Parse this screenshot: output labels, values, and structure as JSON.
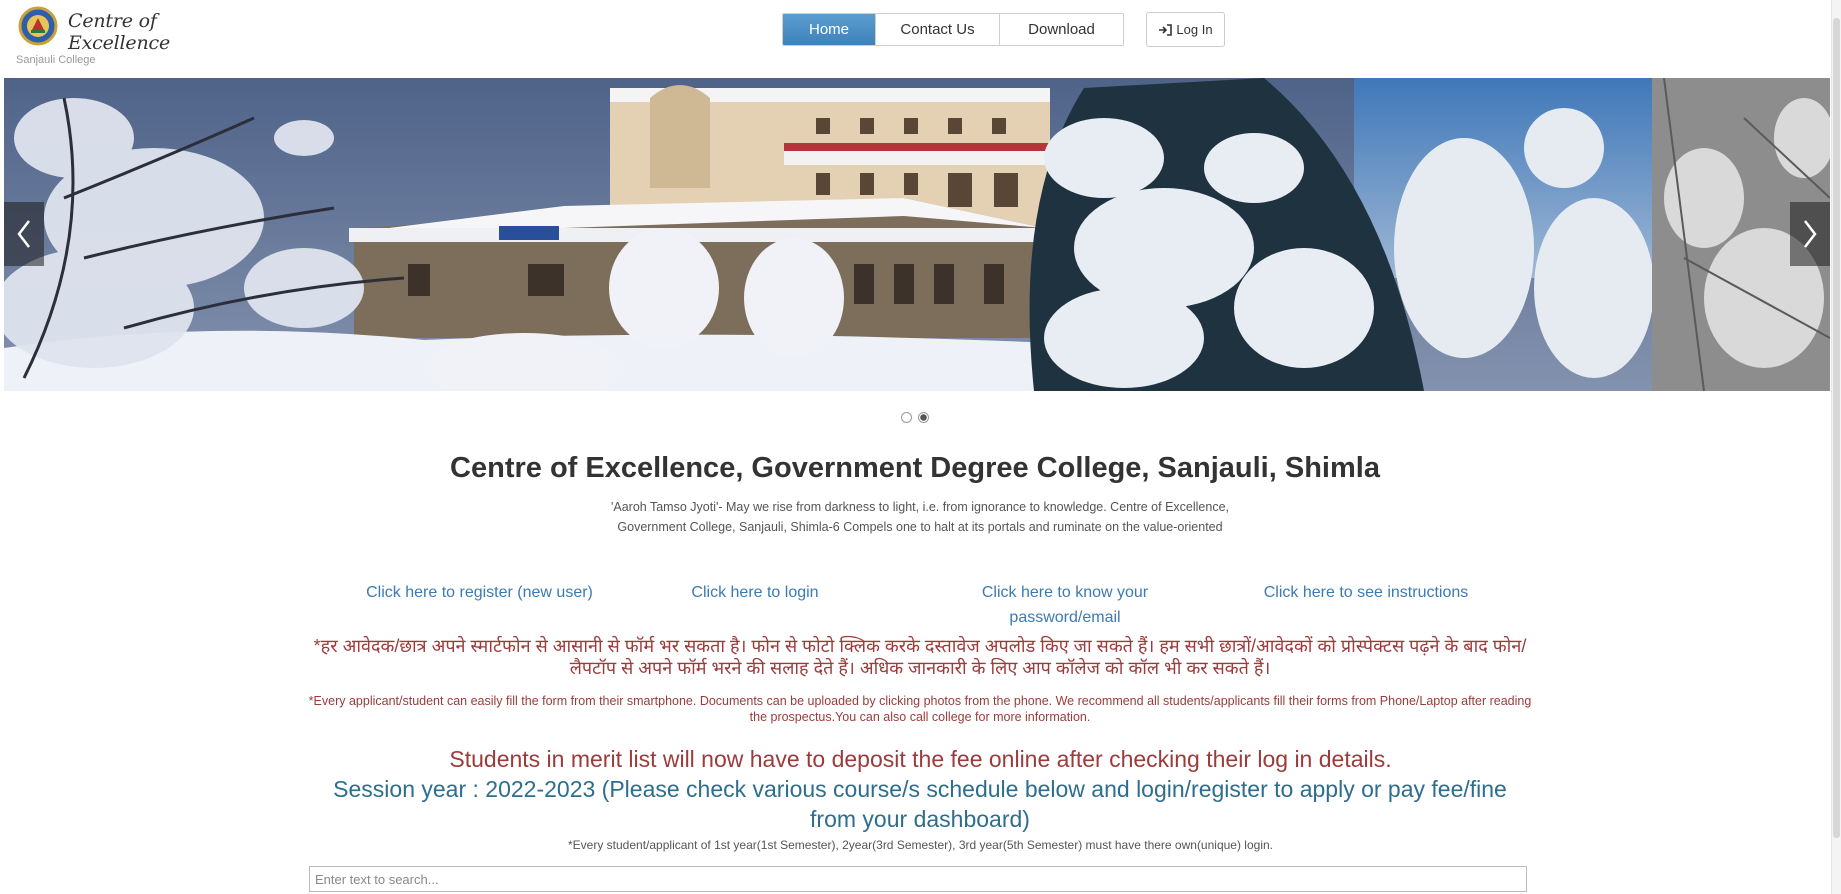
{
  "header": {
    "logo_title": "Centre of Excellence",
    "logo_subtitle": "Sanjauli College",
    "nav": {
      "home": "Home",
      "contact": "Contact Us",
      "download": "Download"
    },
    "login_label": "Log In"
  },
  "carousel": {
    "slide_count": 2,
    "active_slide": 2
  },
  "main": {
    "title": "Centre of Excellence, Government Degree College, Sanjauli, Shimla",
    "intro": "'Aaroh Tamso Jyoti'- May we rise from darkness to light, i.e. from ignorance to knowledge. Centre of Excellence, Government College, Sanjauli, Shimla-6 Compels one to halt at its portals and ruminate on the value-oriented",
    "links": {
      "register": "Click here to register (new user)",
      "login": "Click here to login",
      "password": "Click here to know your password/email",
      "instructions": "Click here to see instructions"
    },
    "hindi_note": "*हर आवेदक/छात्र अपने स्मार्टफोन से आसानी से फॉर्म भर सकता है। फोन से फोटो क्लिक करके दस्तावेज अपलोड किए जा सकते हैं। हम सभी छात्रों/आवेदकों को प्रोस्पेक्टस पढ़ने के बाद फोन/लैपटॉप से अपने फॉर्म भरने की सलाह देते हैं। अधिक जानकारी के लिए आप कॉलेज को कॉल भी कर सकते हैं।",
    "english_note": "*Every applicant/student can easily fill the form from their smartphone. Documents can be uploaded by clicking photos from the phone. We recommend all students/applicants fill their forms from Phone/Laptop after reading the prospectus.You can also call college for more information.",
    "merit_notice": "Students in merit list will now have to deposit the fee online after checking their log in details.",
    "session_notice": "Session year : 2022-2023 (Please check various course/s schedule below and login/register to apply or pay fee/fine from your dashboard)",
    "unique_login_note": "*Every student/applicant of 1st year(1st Semester), 2year(3rd Semester), 3rd year(5th Semester) must have there own(unique) login."
  },
  "search": {
    "placeholder": "Enter text to search..."
  },
  "colors": {
    "nav_active": "#4a8fc6",
    "link": "#3b7bb4",
    "notice_red": "#9c3b3b",
    "session_teal": "#2d6e8e"
  }
}
